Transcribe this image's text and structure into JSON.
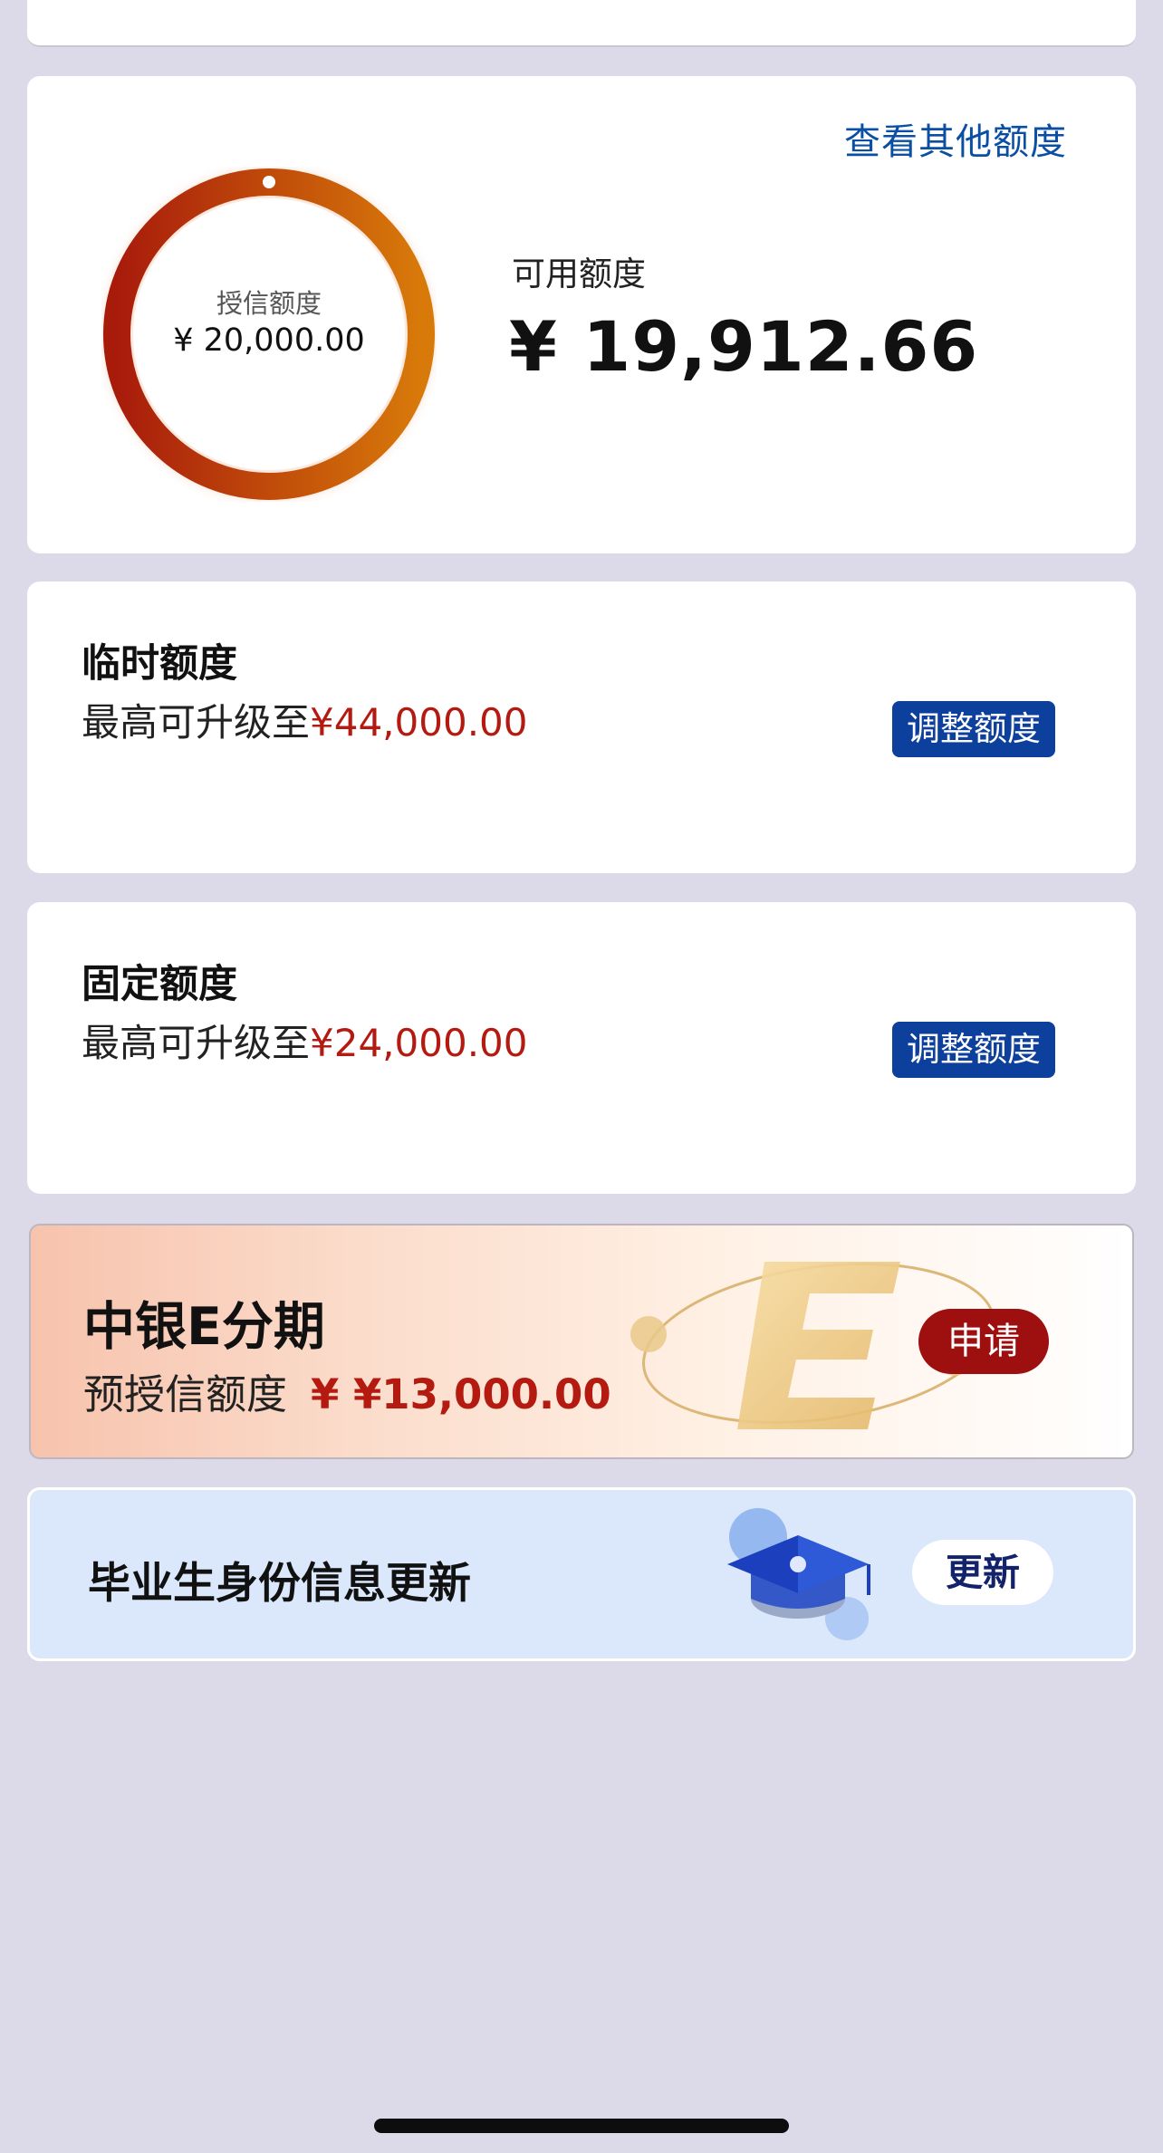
{
  "credit": {
    "other_link": "查看其他额度",
    "ring_label": "授信额度",
    "ring_amount": "¥ 20,000.00",
    "available_label": "可用额度",
    "available_amount": "¥ 19,912.66",
    "used_fraction": 0.0044,
    "ring_colors": [
      "#a81b0b",
      "#d87a0a"
    ]
  },
  "temporary": {
    "title": "临时额度",
    "sub_prefix": "最高可升级至",
    "sub_amount": "¥44,000.00",
    "button": "调整额度"
  },
  "fixed": {
    "title": "固定额度",
    "sub_prefix": "最高可升级至",
    "sub_amount": "¥24,000.00",
    "button": "调整额度"
  },
  "e_installment": {
    "title": "中银E分期",
    "sub_label": "预授信额度",
    "sub_amount": "¥13,000.00",
    "button": "申请"
  },
  "graduate": {
    "title": "毕业生身份信息更新",
    "button": "更新"
  },
  "colors": {
    "accent_blue": "#0d3f9c",
    "link_blue": "#0a4fa3",
    "amount_red": "#b41a10",
    "apply_red": "#9e1010",
    "background": "#dcdae9"
  }
}
